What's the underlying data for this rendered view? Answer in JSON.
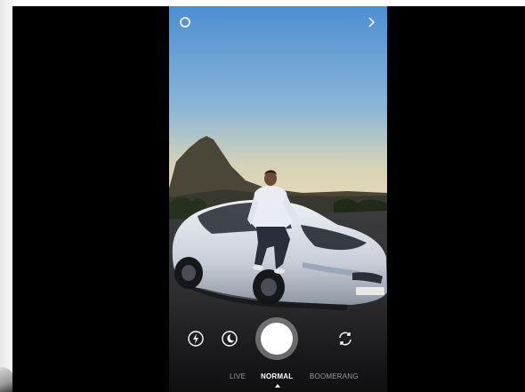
{
  "camera": {
    "top_bar": {
      "settings_icon": "circle-settings-icon",
      "next_icon": "chevron-right-icon"
    },
    "controls": {
      "flash_icon": "flash-icon",
      "night_mode_icon": "moon-icon",
      "shutter": "shutter-button",
      "flip_icon": "flip-camera-icon"
    },
    "modes": [
      {
        "label": "LIVE"
      },
      {
        "label": "NORMAL",
        "selected": true
      },
      {
        "label": "BOOMERANG"
      }
    ],
    "colors": {
      "sky_top": "#4d8ed2",
      "sky_bottom": "#ead9b4",
      "car_body": "#d9dee6",
      "mountain": "#4a4638"
    }
  }
}
